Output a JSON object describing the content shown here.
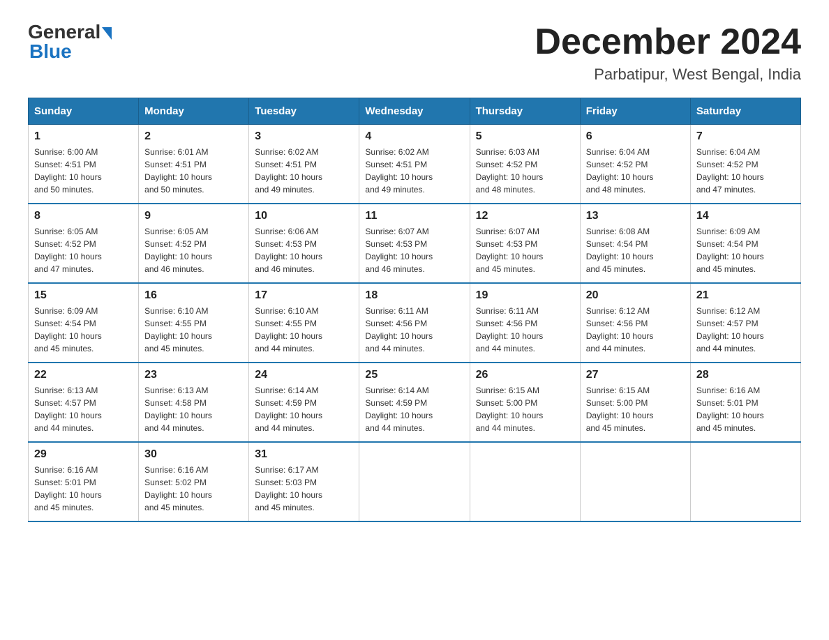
{
  "logo": {
    "general": "General",
    "blue": "Blue"
  },
  "title": {
    "month": "December 2024",
    "location": "Parbatipur, West Bengal, India"
  },
  "days_of_week": [
    "Sunday",
    "Monday",
    "Tuesday",
    "Wednesday",
    "Thursday",
    "Friday",
    "Saturday"
  ],
  "weeks": [
    [
      {
        "day": "1",
        "sunrise": "6:00 AM",
        "sunset": "4:51 PM",
        "daylight": "10 hours and 50 minutes."
      },
      {
        "day": "2",
        "sunrise": "6:01 AM",
        "sunset": "4:51 PM",
        "daylight": "10 hours and 50 minutes."
      },
      {
        "day": "3",
        "sunrise": "6:02 AM",
        "sunset": "4:51 PM",
        "daylight": "10 hours and 49 minutes."
      },
      {
        "day": "4",
        "sunrise": "6:02 AM",
        "sunset": "4:51 PM",
        "daylight": "10 hours and 49 minutes."
      },
      {
        "day": "5",
        "sunrise": "6:03 AM",
        "sunset": "4:52 PM",
        "daylight": "10 hours and 48 minutes."
      },
      {
        "day": "6",
        "sunrise": "6:04 AM",
        "sunset": "4:52 PM",
        "daylight": "10 hours and 48 minutes."
      },
      {
        "day": "7",
        "sunrise": "6:04 AM",
        "sunset": "4:52 PM",
        "daylight": "10 hours and 47 minutes."
      }
    ],
    [
      {
        "day": "8",
        "sunrise": "6:05 AM",
        "sunset": "4:52 PM",
        "daylight": "10 hours and 47 minutes."
      },
      {
        "day": "9",
        "sunrise": "6:05 AM",
        "sunset": "4:52 PM",
        "daylight": "10 hours and 46 minutes."
      },
      {
        "day": "10",
        "sunrise": "6:06 AM",
        "sunset": "4:53 PM",
        "daylight": "10 hours and 46 minutes."
      },
      {
        "day": "11",
        "sunrise": "6:07 AM",
        "sunset": "4:53 PM",
        "daylight": "10 hours and 46 minutes."
      },
      {
        "day": "12",
        "sunrise": "6:07 AM",
        "sunset": "4:53 PM",
        "daylight": "10 hours and 45 minutes."
      },
      {
        "day": "13",
        "sunrise": "6:08 AM",
        "sunset": "4:54 PM",
        "daylight": "10 hours and 45 minutes."
      },
      {
        "day": "14",
        "sunrise": "6:09 AM",
        "sunset": "4:54 PM",
        "daylight": "10 hours and 45 minutes."
      }
    ],
    [
      {
        "day": "15",
        "sunrise": "6:09 AM",
        "sunset": "4:54 PM",
        "daylight": "10 hours and 45 minutes."
      },
      {
        "day": "16",
        "sunrise": "6:10 AM",
        "sunset": "4:55 PM",
        "daylight": "10 hours and 45 minutes."
      },
      {
        "day": "17",
        "sunrise": "6:10 AM",
        "sunset": "4:55 PM",
        "daylight": "10 hours and 44 minutes."
      },
      {
        "day": "18",
        "sunrise": "6:11 AM",
        "sunset": "4:56 PM",
        "daylight": "10 hours and 44 minutes."
      },
      {
        "day": "19",
        "sunrise": "6:11 AM",
        "sunset": "4:56 PM",
        "daylight": "10 hours and 44 minutes."
      },
      {
        "day": "20",
        "sunrise": "6:12 AM",
        "sunset": "4:56 PM",
        "daylight": "10 hours and 44 minutes."
      },
      {
        "day": "21",
        "sunrise": "6:12 AM",
        "sunset": "4:57 PM",
        "daylight": "10 hours and 44 minutes."
      }
    ],
    [
      {
        "day": "22",
        "sunrise": "6:13 AM",
        "sunset": "4:57 PM",
        "daylight": "10 hours and 44 minutes."
      },
      {
        "day": "23",
        "sunrise": "6:13 AM",
        "sunset": "4:58 PM",
        "daylight": "10 hours and 44 minutes."
      },
      {
        "day": "24",
        "sunrise": "6:14 AM",
        "sunset": "4:59 PM",
        "daylight": "10 hours and 44 minutes."
      },
      {
        "day": "25",
        "sunrise": "6:14 AM",
        "sunset": "4:59 PM",
        "daylight": "10 hours and 44 minutes."
      },
      {
        "day": "26",
        "sunrise": "6:15 AM",
        "sunset": "5:00 PM",
        "daylight": "10 hours and 44 minutes."
      },
      {
        "day": "27",
        "sunrise": "6:15 AM",
        "sunset": "5:00 PM",
        "daylight": "10 hours and 45 minutes."
      },
      {
        "day": "28",
        "sunrise": "6:16 AM",
        "sunset": "5:01 PM",
        "daylight": "10 hours and 45 minutes."
      }
    ],
    [
      {
        "day": "29",
        "sunrise": "6:16 AM",
        "sunset": "5:01 PM",
        "daylight": "10 hours and 45 minutes."
      },
      {
        "day": "30",
        "sunrise": "6:16 AM",
        "sunset": "5:02 PM",
        "daylight": "10 hours and 45 minutes."
      },
      {
        "day": "31",
        "sunrise": "6:17 AM",
        "sunset": "5:03 PM",
        "daylight": "10 hours and 45 minutes."
      },
      null,
      null,
      null,
      null
    ]
  ],
  "labels": {
    "sunrise": "Sunrise:",
    "sunset": "Sunset:",
    "daylight": "Daylight:"
  }
}
